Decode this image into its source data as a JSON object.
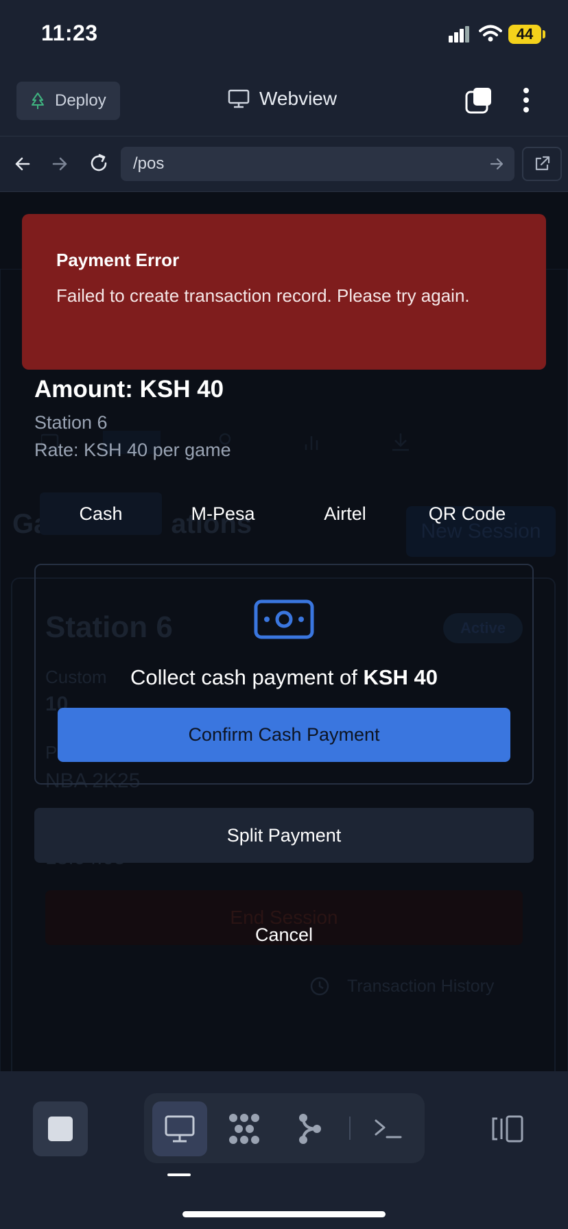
{
  "status_bar": {
    "time": "11:23",
    "battery": "44"
  },
  "toolbar": {
    "deploy_label": "Deploy",
    "title": "Webview"
  },
  "address_bar": {
    "url": "/pos"
  },
  "background_page": {
    "heading_fragment": "Ga",
    "heading_fragment_end": "ations",
    "new_session_label": "New Session",
    "card_title": "Station 6",
    "card_status": "Active",
    "customers_fragment": "Custom",
    "customers_value": "10",
    "game_label_fragment": "P",
    "game_value": "NBA 2K25",
    "time_fragment": "18:04:05",
    "end_session_label": "End Session",
    "history_label": "Transaction History"
  },
  "toast": {
    "title": "Payment Error",
    "message": "Failed to create transaction record. Please try again."
  },
  "modal": {
    "amount": "Amount: KSH 40",
    "station": "Station 6",
    "rate": "Rate: KSH 40 per game",
    "tabs": [
      {
        "label": "Cash",
        "active": true
      },
      {
        "label": "M-Pesa",
        "active": false
      },
      {
        "label": "Airtel",
        "active": false
      },
      {
        "label": "QR Code",
        "active": false
      }
    ],
    "cash_panel": {
      "collect_prefix": "Collect cash payment of ",
      "collect_amount": "KSH 40",
      "confirm_label": "Confirm Cash Payment"
    },
    "split_label": "Split Payment",
    "cancel_label": "Cancel"
  },
  "colors": {
    "toast_bg": "#7f1d1d",
    "confirm_bg": "#3a76df",
    "cash_icon": "#3a76df"
  }
}
